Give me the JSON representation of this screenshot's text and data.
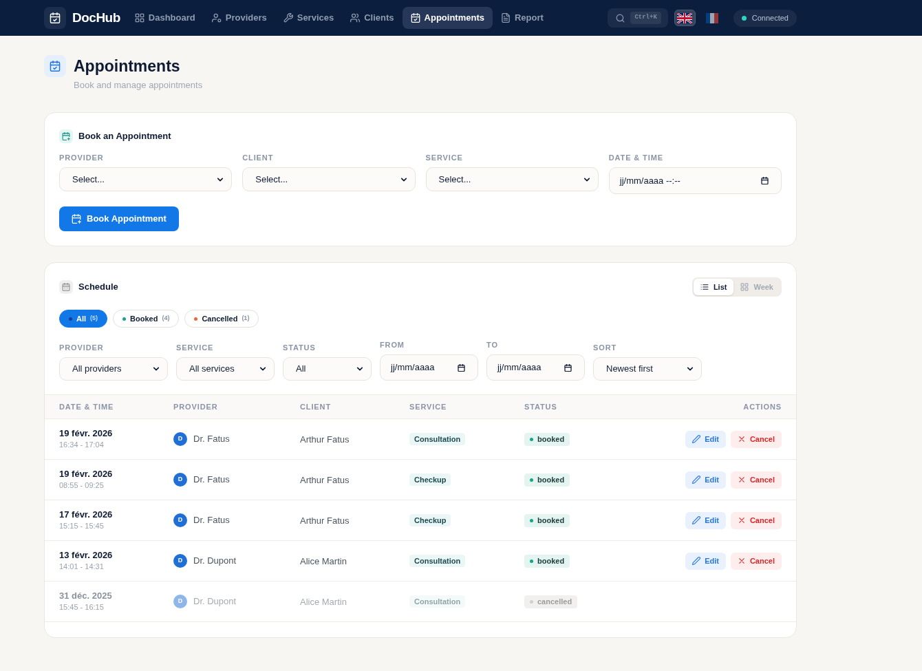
{
  "nav": {
    "brand": "DocHub",
    "items": [
      {
        "label": "Dashboard",
        "selected": false
      },
      {
        "label": "Providers",
        "selected": false
      },
      {
        "label": "Services",
        "selected": false
      },
      {
        "label": "Clients",
        "selected": false
      },
      {
        "label": "Appointments",
        "selected": true
      },
      {
        "label": "Report",
        "selected": false
      }
    ],
    "search": {
      "shortcut": "Ctrl+K"
    },
    "languages": [
      {
        "selected": true
      },
      {
        "selected": false
      }
    ],
    "connection": {
      "label": "Connected",
      "online": true
    }
  },
  "header": {
    "title": "Appointments",
    "subtitle": "Book and manage appointments"
  },
  "booking": {
    "title": "Book an Appointment",
    "fields": [
      {
        "label": "PROVIDER",
        "kind": "select",
        "value": "Select..."
      },
      {
        "label": "CLIENT",
        "kind": "select",
        "value": "Select..."
      },
      {
        "label": "SERVICE",
        "kind": "select",
        "value": "Select..."
      },
      {
        "label": "DATE & TIME",
        "kind": "datetime",
        "placeholder": "jj/mm/aaaa --:--"
      }
    ],
    "button": "Book Appointment"
  },
  "schedule": {
    "title": "Schedule",
    "views": [
      {
        "label": "List",
        "selected": true
      },
      {
        "label": "Week",
        "selected": false
      }
    ],
    "chips": [
      {
        "label": "All",
        "count": "(5)",
        "selected": true,
        "color": "#1e3a8a"
      },
      {
        "label": "Booked",
        "count": "(4)",
        "selected": false,
        "color": "#14a38b"
      },
      {
        "label": "Cancelled",
        "count": "(1)",
        "selected": false,
        "color": "#f0643c"
      }
    ],
    "filters": [
      {
        "label": "PROVIDER",
        "kind": "select",
        "value": "All providers"
      },
      {
        "label": "SERVICE",
        "kind": "select",
        "value": "All services"
      },
      {
        "label": "STATUS",
        "kind": "select",
        "value": "All"
      },
      {
        "label": "FROM",
        "kind": "date",
        "placeholder": "jj/mm/aaaa"
      },
      {
        "label": "TO",
        "kind": "date",
        "placeholder": "jj/mm/aaaa"
      },
      {
        "label": "SORT",
        "kind": "select",
        "value": "Newest first"
      }
    ],
    "table": {
      "columns": [
        "DATE & TIME",
        "PROVIDER",
        "CLIENT",
        "SERVICE",
        "STATUS",
        "ACTIONS"
      ],
      "rows": [
        {
          "date": "19 févr. 2026",
          "time": "16:34 - 17:04",
          "initial": "D",
          "provider": "Dr. Fatus",
          "client": "Arthur Fatus",
          "service": "Consultation",
          "status": "booked",
          "cancelled": false,
          "actions": [
            {
              "label": "Edit",
              "kind": "edit"
            },
            {
              "label": "Cancel",
              "kind": "cancel"
            }
          ]
        },
        {
          "date": "19 févr. 2026",
          "time": "08:55 - 09:25",
          "initial": "D",
          "provider": "Dr. Fatus",
          "client": "Arthur Fatus",
          "service": "Checkup",
          "status": "booked",
          "cancelled": false,
          "actions": [
            {
              "label": "Edit",
              "kind": "edit"
            },
            {
              "label": "Cancel",
              "kind": "cancel"
            }
          ]
        },
        {
          "date": "17 févr. 2026",
          "time": "15:15 - 15:45",
          "initial": "D",
          "provider": "Dr. Fatus",
          "client": "Arthur Fatus",
          "service": "Checkup",
          "status": "booked",
          "cancelled": false,
          "actions": [
            {
              "label": "Edit",
              "kind": "edit"
            },
            {
              "label": "Cancel",
              "kind": "cancel"
            }
          ]
        },
        {
          "date": "13 févr. 2026",
          "time": "14:01 - 14:31",
          "initial": "D",
          "provider": "Dr. Dupont",
          "client": "Alice Martin",
          "service": "Consultation",
          "status": "booked",
          "cancelled": false,
          "actions": [
            {
              "label": "Edit",
              "kind": "edit"
            },
            {
              "label": "Cancel",
              "kind": "cancel"
            }
          ]
        },
        {
          "date": "31 déc. 2025",
          "time": "15:45 - 16:15",
          "initial": "D",
          "provider": "Dr. Dupont",
          "client": "Alice Martin",
          "service": "Consultation",
          "status": "cancelled",
          "cancelled": true
        }
      ]
    }
  }
}
